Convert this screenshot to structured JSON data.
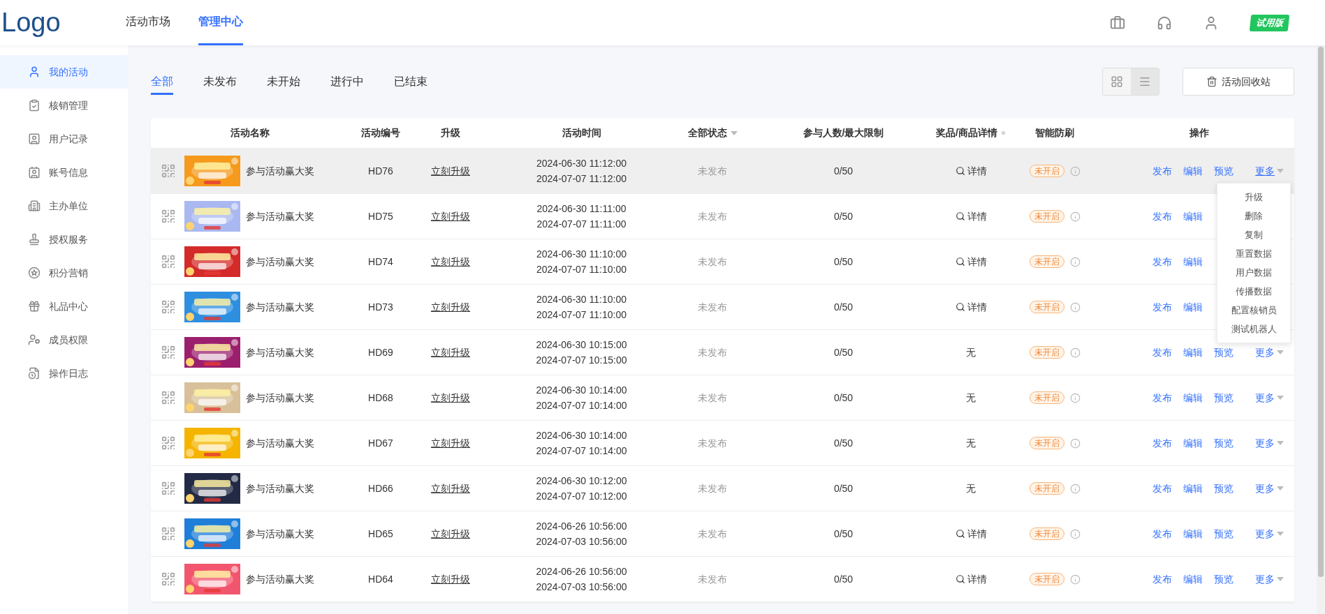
{
  "header": {
    "logo": "Logo",
    "nav": [
      {
        "label": "活动市场",
        "selected": false
      },
      {
        "label": "管理中心",
        "selected": true
      }
    ],
    "badge": "试用版"
  },
  "sidebar": {
    "items": [
      {
        "label": "我的活动",
        "selected": true
      },
      {
        "label": "核销管理",
        "selected": false
      },
      {
        "label": "用户记录",
        "selected": false
      },
      {
        "label": "账号信息",
        "selected": false
      },
      {
        "label": "主办单位",
        "selected": false
      },
      {
        "label": "授权服务",
        "selected": false
      },
      {
        "label": "积分营销",
        "selected": false
      },
      {
        "label": "礼品中心",
        "selected": false
      },
      {
        "label": "成员权限",
        "selected": false
      },
      {
        "label": "操作日志",
        "selected": false
      }
    ]
  },
  "tabs": [
    {
      "label": "全部",
      "selected": true
    },
    {
      "label": "未发布",
      "selected": false
    },
    {
      "label": "未开始",
      "selected": false
    },
    {
      "label": "进行中",
      "selected": false
    },
    {
      "label": "已结束",
      "selected": false
    }
  ],
  "view_toggle": [
    {
      "kind": "grid",
      "selected": false
    },
    {
      "kind": "list",
      "selected": true
    }
  ],
  "recycle_button": "活动回收站",
  "table": {
    "columns": [
      "活动名称",
      "活动编号",
      "升级",
      "活动时间",
      "全部状态",
      "参与人数/最大限制",
      "奖品/商品详情",
      "智能防刷",
      "操作"
    ],
    "rows": [
      {
        "hovered": true,
        "name": "参与活动赢大奖",
        "code": "HD76",
        "upgrade": "立刻升级",
        "start": "2024-06-30 11:12:00",
        "end": "2024-07-07 11:12:00",
        "status": "未发布",
        "participants": "0/50",
        "prize": {
          "kind": "detail",
          "label": "详情"
        },
        "anti": "未开启",
        "actions": [
          "发布",
          "编辑",
          "预览"
        ],
        "more": {
          "label": "更多",
          "open": true
        }
      },
      {
        "hovered": false,
        "name": "参与活动赢大奖",
        "code": "HD75",
        "upgrade": "立刻升级",
        "start": "2024-06-30 11:11:00",
        "end": "2024-07-07 11:11:00",
        "status": "未发布",
        "participants": "0/50",
        "prize": {
          "kind": "detail",
          "label": "详情"
        },
        "anti": "未开启",
        "actions": [
          "发布",
          "编辑"
        ]
      },
      {
        "hovered": false,
        "name": "参与活动赢大奖",
        "code": "HD74",
        "upgrade": "立刻升级",
        "start": "2024-06-30 11:10:00",
        "end": "2024-07-07 11:10:00",
        "status": "未发布",
        "participants": "0/50",
        "prize": {
          "kind": "detail",
          "label": "详情"
        },
        "anti": "未开启",
        "actions": [
          "发布",
          "编辑"
        ]
      },
      {
        "hovered": false,
        "name": "参与活动赢大奖",
        "code": "HD73",
        "upgrade": "立刻升级",
        "start": "2024-06-30 11:10:00",
        "end": "2024-07-07 11:10:00",
        "status": "未发布",
        "participants": "0/50",
        "prize": {
          "kind": "detail",
          "label": "详情"
        },
        "anti": "未开启",
        "actions": [
          "发布",
          "编辑"
        ]
      },
      {
        "hovered": false,
        "name": "参与活动赢大奖",
        "code": "HD69",
        "upgrade": "立刻升级",
        "start": "2024-06-30 10:15:00",
        "end": "2024-07-07 10:15:00",
        "status": "未发布",
        "participants": "0/50",
        "prize": {
          "kind": "none",
          "label": "无"
        },
        "anti": "未开启",
        "actions": [
          "发布",
          "编辑",
          "预览"
        ],
        "more": {
          "label": "更多",
          "open": false
        }
      },
      {
        "hovered": false,
        "name": "参与活动赢大奖",
        "code": "HD68",
        "upgrade": "立刻升级",
        "start": "2024-06-30 10:14:00",
        "end": "2024-07-07 10:14:00",
        "status": "未发布",
        "participants": "0/50",
        "prize": {
          "kind": "none",
          "label": "无"
        },
        "anti": "未开启",
        "actions": [
          "发布",
          "编辑",
          "预览"
        ],
        "more": {
          "label": "更多",
          "open": false
        }
      },
      {
        "hovered": false,
        "name": "参与活动赢大奖",
        "code": "HD67",
        "upgrade": "立刻升级",
        "start": "2024-06-30 10:14:00",
        "end": "2024-07-07 10:14:00",
        "status": "未发布",
        "participants": "0/50",
        "prize": {
          "kind": "none",
          "label": "无"
        },
        "anti": "未开启",
        "actions": [
          "发布",
          "编辑",
          "预览"
        ],
        "more": {
          "label": "更多",
          "open": false
        }
      },
      {
        "hovered": false,
        "name": "参与活动赢大奖",
        "code": "HD66",
        "upgrade": "立刻升级",
        "start": "2024-06-30 10:12:00",
        "end": "2024-07-07 10:12:00",
        "status": "未发布",
        "participants": "0/50",
        "prize": {
          "kind": "none",
          "label": "无"
        },
        "anti": "未开启",
        "actions": [
          "发布",
          "编辑",
          "预览"
        ],
        "more": {
          "label": "更多",
          "open": false
        }
      },
      {
        "hovered": false,
        "name": "参与活动赢大奖",
        "code": "HD65",
        "upgrade": "立刻升级",
        "start": "2024-06-26 10:56:00",
        "end": "2024-07-03 10:56:00",
        "status": "未发布",
        "participants": "0/50",
        "prize": {
          "kind": "detail",
          "label": "详情"
        },
        "anti": "未开启",
        "actions": [
          "发布",
          "编辑",
          "预览"
        ],
        "more": {
          "label": "更多",
          "open": false
        }
      },
      {
        "hovered": false,
        "name": "参与活动赢大奖",
        "code": "HD64",
        "upgrade": "立刻升级",
        "start": "2024-06-26 10:56:00",
        "end": "2024-07-03 10:56:00",
        "status": "未发布",
        "participants": "0/50",
        "prize": {
          "kind": "detail",
          "label": "详情"
        },
        "anti": "未开启",
        "actions": [
          "发布",
          "编辑",
          "预览"
        ],
        "more": {
          "label": "更多",
          "open": false
        }
      }
    ]
  },
  "more_menu": [
    "升级",
    "删除",
    "复制",
    "重置数据",
    "用户数据",
    "传播数据",
    "配置核销员",
    "测试机器人"
  ]
}
